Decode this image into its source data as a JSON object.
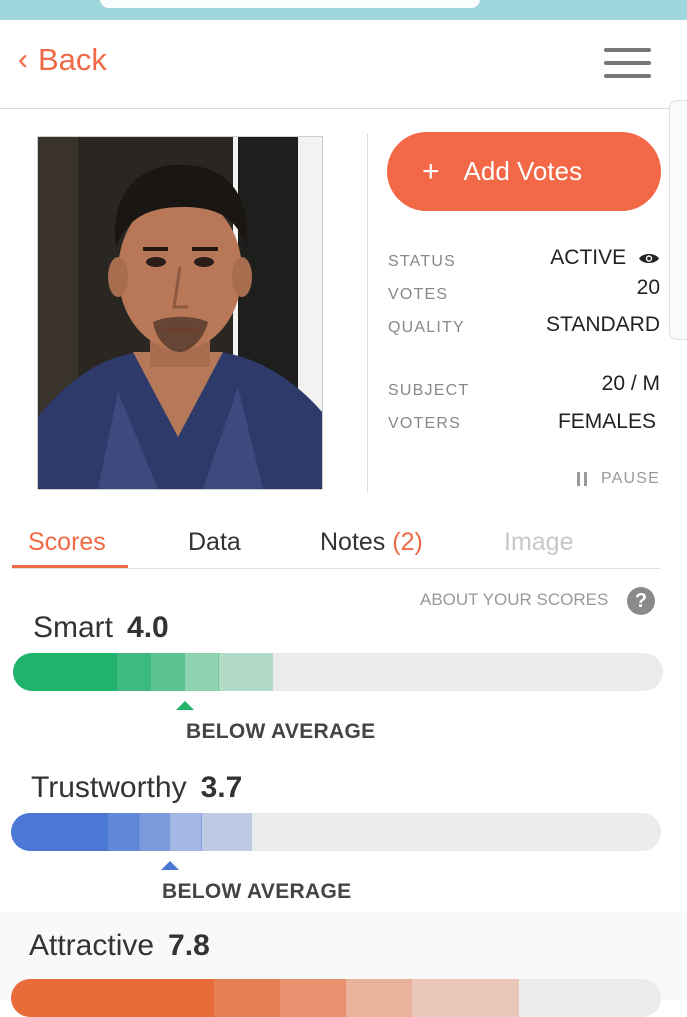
{
  "nav": {
    "back_label": "Back",
    "back_chevron": "‹"
  },
  "actions": {
    "add_votes_label": "Add Votes",
    "add_votes_icon": "+"
  },
  "stats": {
    "status_label": "STATUS",
    "status_value": "ACTIVE",
    "votes_label": "VOTES",
    "votes_value": "20",
    "quality_label": "QUALITY",
    "quality_value": "STANDARD",
    "subject_label": "SUBJECT",
    "subject_value": "20 / M",
    "voters_label": "VOTERS",
    "voters_value": "FEMALES",
    "pause_label": "PAUSE"
  },
  "tabs": [
    {
      "label": "Scores"
    },
    {
      "label": "Data"
    },
    {
      "label": "Notes",
      "count": "(2)"
    },
    {
      "label": "Image"
    }
  ],
  "about_label": "ABOUT YOUR SCORES",
  "help_icon": "?",
  "scores": [
    {
      "name": "Smart",
      "value": "4.0",
      "level": 0.4,
      "rating": "BELOW AVERAGE",
      "color": "#1fb36b"
    },
    {
      "name": "Trustworthy",
      "value": "3.7",
      "level": 0.37,
      "rating": "BELOW AVERAGE",
      "color": "#4a78d4"
    },
    {
      "name": "Attractive",
      "value": "7.8",
      "level": 0.78,
      "color": "#e86b3a"
    }
  ]
}
